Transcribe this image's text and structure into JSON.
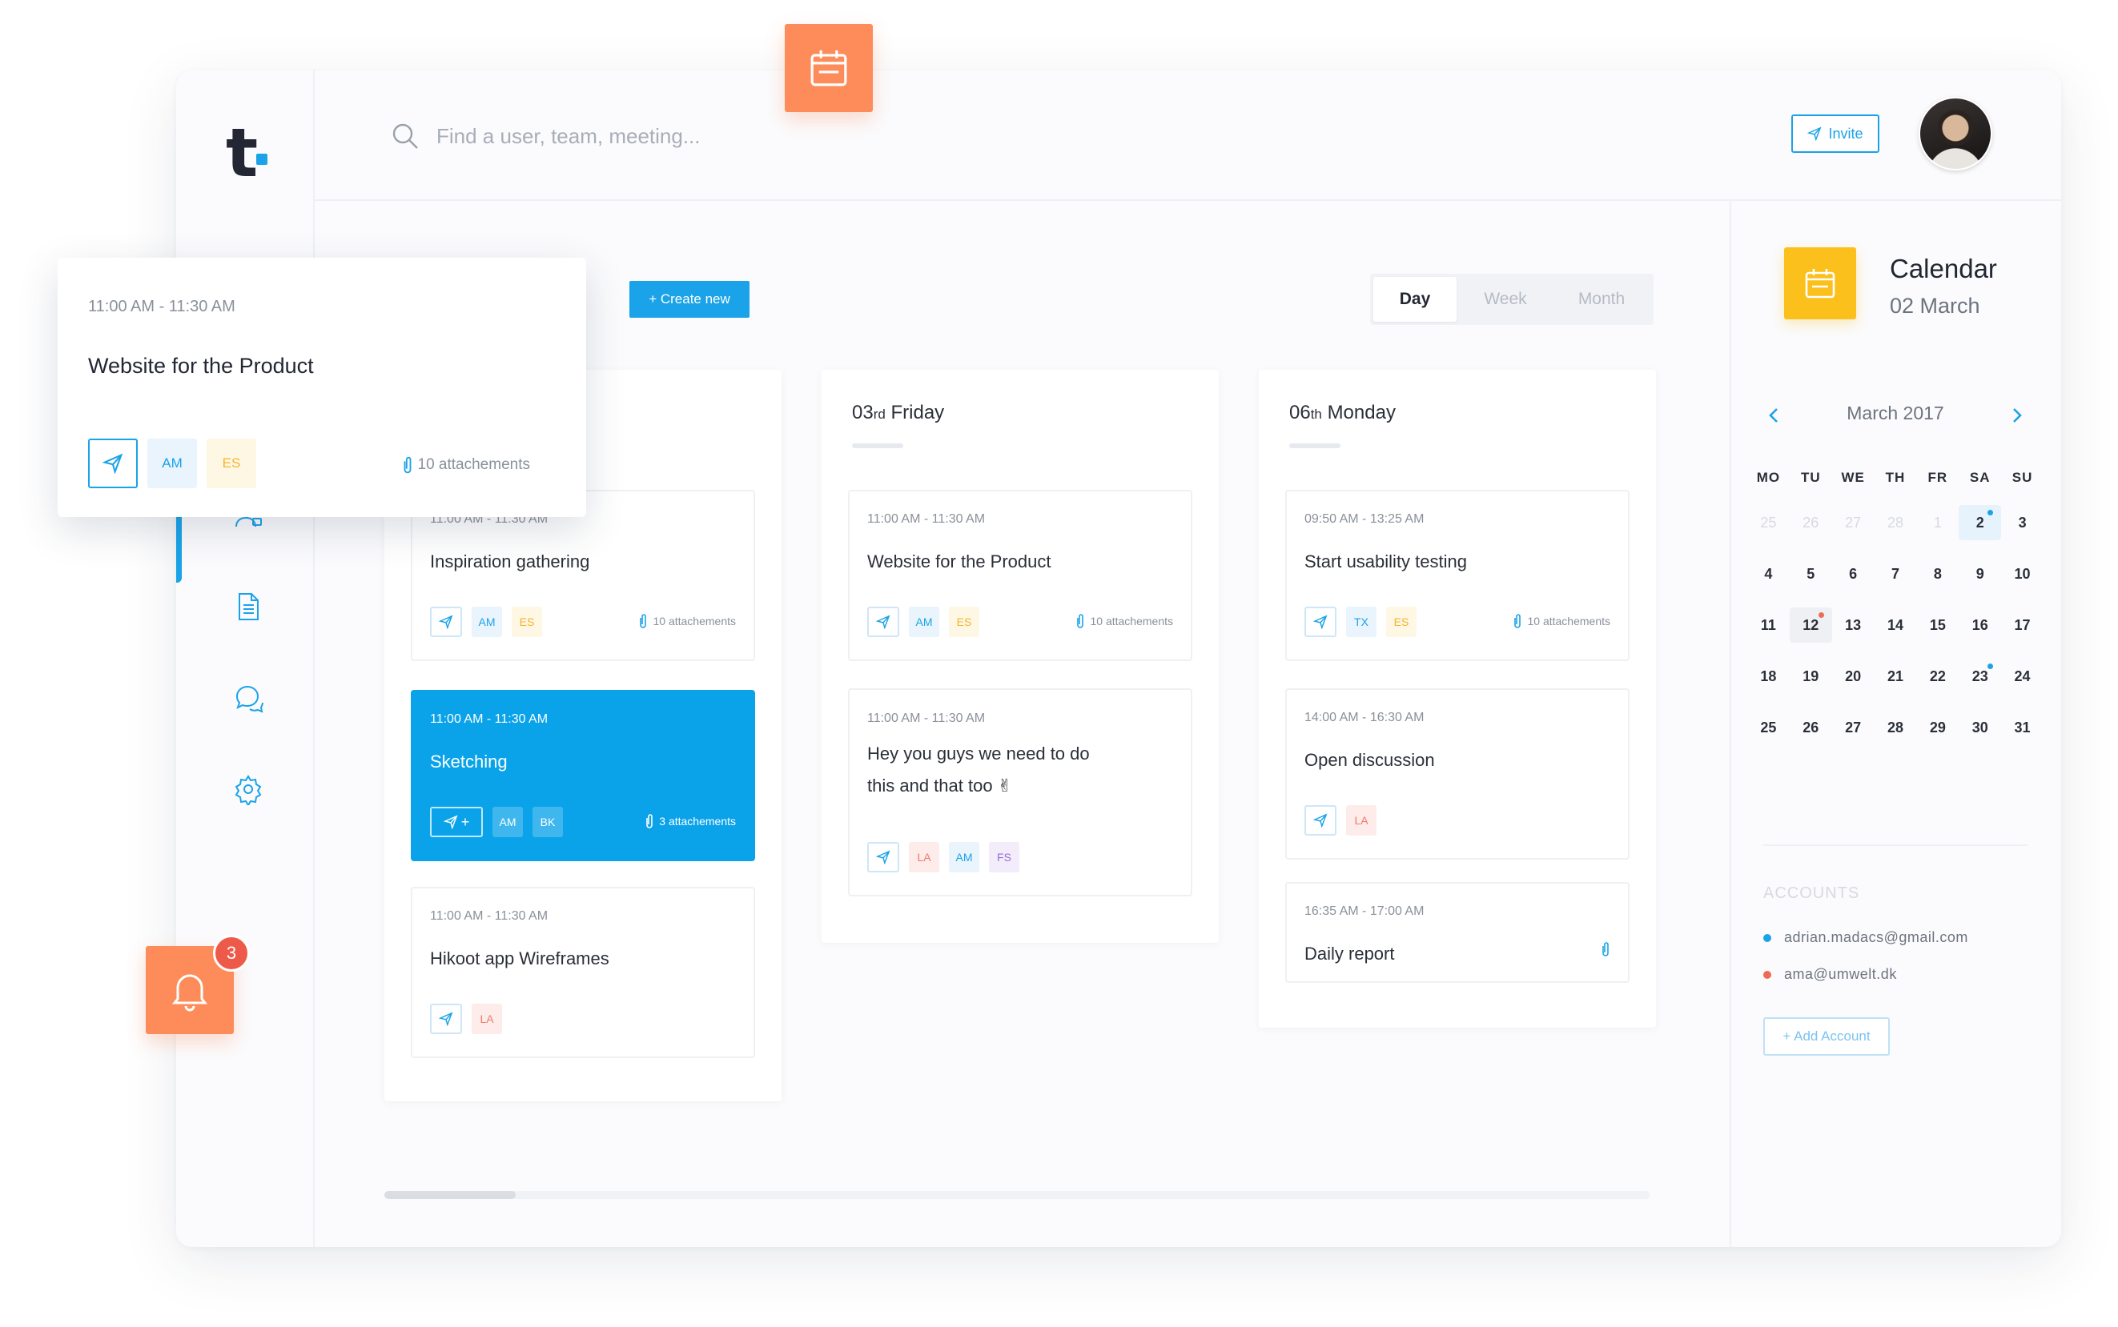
{
  "brand": {
    "logo": "t",
    "accent": "#1aa3e8"
  },
  "search": {
    "placeholder": "Find a user, team, meeting..."
  },
  "header": {
    "invite_label": "Invite"
  },
  "toolbar": {
    "create_label": "+ Create new"
  },
  "view_tabs": {
    "day": "Day",
    "week": "Week",
    "month": "Month",
    "selected": "Day"
  },
  "floating_card": {
    "time": "11:00 AM - 11:30 AM",
    "title": "Website for the Product",
    "tags": [
      "AM",
      "ES"
    ],
    "attachments": "10 attachements"
  },
  "notifications": {
    "count": "3"
  },
  "columns": [
    {
      "cards": [
        {
          "time": "11:00 AM - 11:30 AM",
          "title": "Inspiration gathering",
          "tags": [
            "AM",
            "ES"
          ],
          "attachments": "10 attachements"
        },
        {
          "time": "11:00 AM - 11:30 AM",
          "title": "Sketching",
          "send_extra": "+",
          "tags": [
            "AM",
            "BK"
          ],
          "attachments": "3 attachements",
          "selected": true
        },
        {
          "time": "11:00 AM - 11:30 AM",
          "title": "Hikoot app Wireframes",
          "tags": [
            "LA"
          ]
        }
      ]
    },
    {
      "day_num": "03",
      "day_suffix": "rd",
      "day_name": "Friday",
      "cards": [
        {
          "time": "11:00 AM - 11:30 AM",
          "title": "Website for the Product",
          "tags": [
            "AM",
            "ES"
          ],
          "attachments": "10 attachements"
        },
        {
          "time": "11:00 AM - 11:30 AM",
          "title": "Hey you guys we need to do this and that too ✌",
          "tags": [
            "LA",
            "AM",
            "FS"
          ]
        }
      ]
    },
    {
      "day_num": "06",
      "day_suffix": "th",
      "day_name": "Monday",
      "cards": [
        {
          "time": "09:50 AM - 13:25 AM",
          "title": "Start usability testing",
          "tags": [
            "TX",
            "ES"
          ],
          "attachments": "10 attachements"
        },
        {
          "time": "14:00 AM - 16:30 AM",
          "title": "Open discussion",
          "tags": [
            "LA"
          ]
        },
        {
          "time": "16:35 AM - 17:00 AM",
          "title": "Daily report"
        }
      ]
    }
  ],
  "calendar": {
    "title": "Calendar",
    "date": "02 March",
    "month_label": "March 2017",
    "weekdays": [
      "MO",
      "TU",
      "WE",
      "TH",
      "FR",
      "SA",
      "SU"
    ],
    "days": [
      {
        "d": "25",
        "muted": true
      },
      {
        "d": "26",
        "muted": true
      },
      {
        "d": "27",
        "muted": true
      },
      {
        "d": "28",
        "muted": true
      },
      {
        "d": "1",
        "muted": true
      },
      {
        "d": "2",
        "selected": true,
        "dot": "blue"
      },
      {
        "d": "3"
      },
      {
        "d": "4"
      },
      {
        "d": "5"
      },
      {
        "d": "6"
      },
      {
        "d": "7"
      },
      {
        "d": "8"
      },
      {
        "d": "9"
      },
      {
        "d": "10"
      },
      {
        "d": "11"
      },
      {
        "d": "12",
        "today": true,
        "dot": "red"
      },
      {
        "d": "13"
      },
      {
        "d": "14"
      },
      {
        "d": "15"
      },
      {
        "d": "16"
      },
      {
        "d": "17"
      },
      {
        "d": "18"
      },
      {
        "d": "19"
      },
      {
        "d": "20"
      },
      {
        "d": "21"
      },
      {
        "d": "22"
      },
      {
        "d": "23",
        "dot": "blue"
      },
      {
        "d": "24"
      },
      {
        "d": "25"
      },
      {
        "d": "26"
      },
      {
        "d": "27"
      },
      {
        "d": "28"
      },
      {
        "d": "29"
      },
      {
        "d": "30"
      },
      {
        "d": "31"
      }
    ]
  },
  "accounts": {
    "label": "ACCOUNTS",
    "items": [
      {
        "email": "adrian.madacs@gmail.com",
        "color": "#1aa3e8"
      },
      {
        "email": "ama@umwelt.dk",
        "color": "#ee6b56"
      }
    ],
    "add_label": "+ Add Account"
  }
}
